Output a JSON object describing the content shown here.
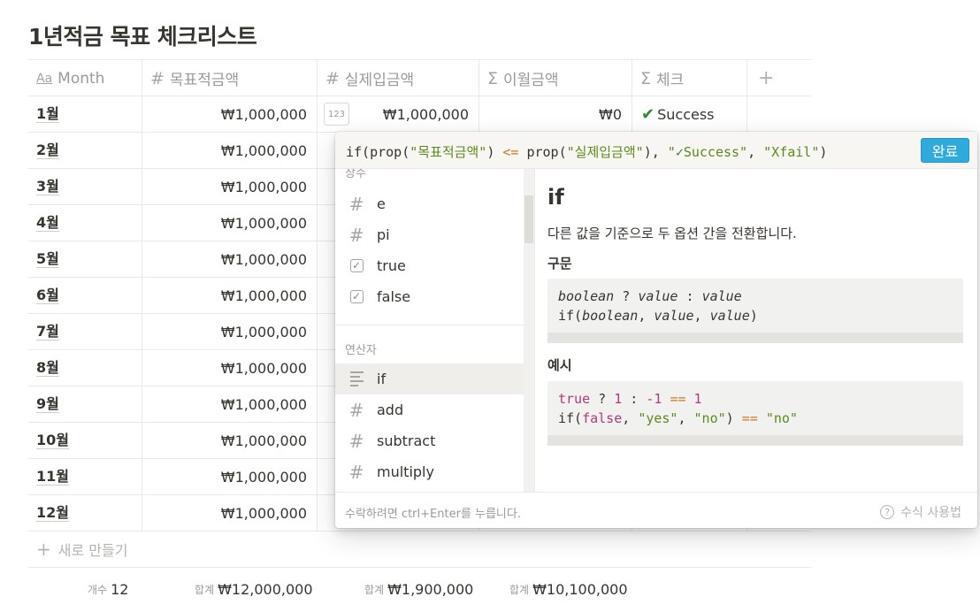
{
  "page": {
    "title": "1년적금 목표 체크리스트"
  },
  "table": {
    "columns": [
      {
        "icon": "text-icon",
        "glyph": "Aa",
        "label": "Month"
      },
      {
        "icon": "number-icon",
        "glyph": "#",
        "label": "목표적금액"
      },
      {
        "icon": "number-icon",
        "glyph": "#",
        "label": "실제입금액"
      },
      {
        "icon": "formula-icon",
        "glyph": "Σ",
        "label": "이월금액"
      },
      {
        "icon": "formula-icon",
        "glyph": "Σ",
        "label": "체크"
      }
    ],
    "add_column_glyph": "+",
    "rows": [
      {
        "month": "1월",
        "target": "₩1,000,000",
        "actual": "₩1,000,000",
        "carry": "₩0",
        "check": "Success"
      },
      {
        "month": "2월",
        "target": "₩1,000,000"
      },
      {
        "month": "3월",
        "target": "₩1,000,000"
      },
      {
        "month": "4월",
        "target": "₩1,000,000"
      },
      {
        "month": "5월",
        "target": "₩1,000,000"
      },
      {
        "month": "6월",
        "target": "₩1,000,000"
      },
      {
        "month": "7월",
        "target": "₩1,000,000"
      },
      {
        "month": "8월",
        "target": "₩1,000,000"
      },
      {
        "month": "9월",
        "target": "₩1,000,000"
      },
      {
        "month": "10월",
        "target": "₩1,000,000"
      },
      {
        "month": "11월",
        "target": "₩1,000,000"
      },
      {
        "month": "12월",
        "target": "₩1,000,000"
      }
    ],
    "number_badge": "123",
    "check_glyph": "✔",
    "new_row_label": "새로 만들기",
    "new_row_glyph": "+",
    "footer": {
      "count_label": "개수",
      "count_value": "12",
      "target_label": "합계",
      "target_value": "₩12,000,000",
      "actual_label": "합계",
      "actual_value": "₩1,900,000",
      "carry_label": "합계",
      "carry_value": "₩10,100,000"
    }
  },
  "formula_popup": {
    "formula": {
      "p1": "if(prop(",
      "s1": "\"목표적금액\"",
      "p2": ") ",
      "op": "<=",
      "p3": " prop(",
      "s2": "\"실제입금액\"",
      "p4": "), ",
      "s3a": "\"",
      "s3check": "✓",
      "s3b": "Success\"",
      "p5": ", ",
      "s4": "\"Xfail\"",
      "p6": ")"
    },
    "done_button": "완료",
    "sections": {
      "constants_label": "상수",
      "operators_label": "연산자"
    },
    "constants": [
      {
        "icon": "number-icon",
        "label": "e"
      },
      {
        "icon": "number-icon",
        "label": "pi"
      },
      {
        "icon": "checkbox-icon",
        "label": "true"
      },
      {
        "icon": "checkbox-icon",
        "label": "false"
      }
    ],
    "operators": [
      {
        "icon": "text-lines-icon",
        "label": "if",
        "selected": true
      },
      {
        "icon": "number-icon",
        "label": "add"
      },
      {
        "icon": "number-icon",
        "label": "subtract"
      },
      {
        "icon": "number-icon",
        "label": "multiply"
      }
    ],
    "detail": {
      "name": "if",
      "description": "다른 값을 기준으로 두 옵션 간을 전환합니다.",
      "syntax_heading": "구문",
      "syntax": {
        "l1a": "boolean",
        "l1b": " ? ",
        "l1c": "value",
        "l1d": " : ",
        "l1e": "value",
        "l2a": "if(",
        "l2b": "boolean",
        "l2c": ", ",
        "l2d": "value",
        "l2e": ", ",
        "l2f": "value",
        "l2g": ")"
      },
      "example_heading": "예시",
      "example": {
        "l1a": "true",
        "l1b": " ? ",
        "l1c": "1",
        "l1d": " : ",
        "l1e": "-1",
        "l1f": " ",
        "l1g": "==",
        "l1h": " ",
        "l1i": "1",
        "l2a": "if(",
        "l2b": "false",
        "l2c": ", ",
        "l2d": "\"yes\"",
        "l2e": ", ",
        "l2f": "\"no\"",
        "l2g": ") ",
        "l2h": "==",
        "l2i": " ",
        "l2j": "\"no\""
      }
    },
    "footer_hint": "수락하려면 ctrl+Enter를 누릅니다.",
    "help_label": "수식 사용법",
    "help_glyph": "?"
  }
}
